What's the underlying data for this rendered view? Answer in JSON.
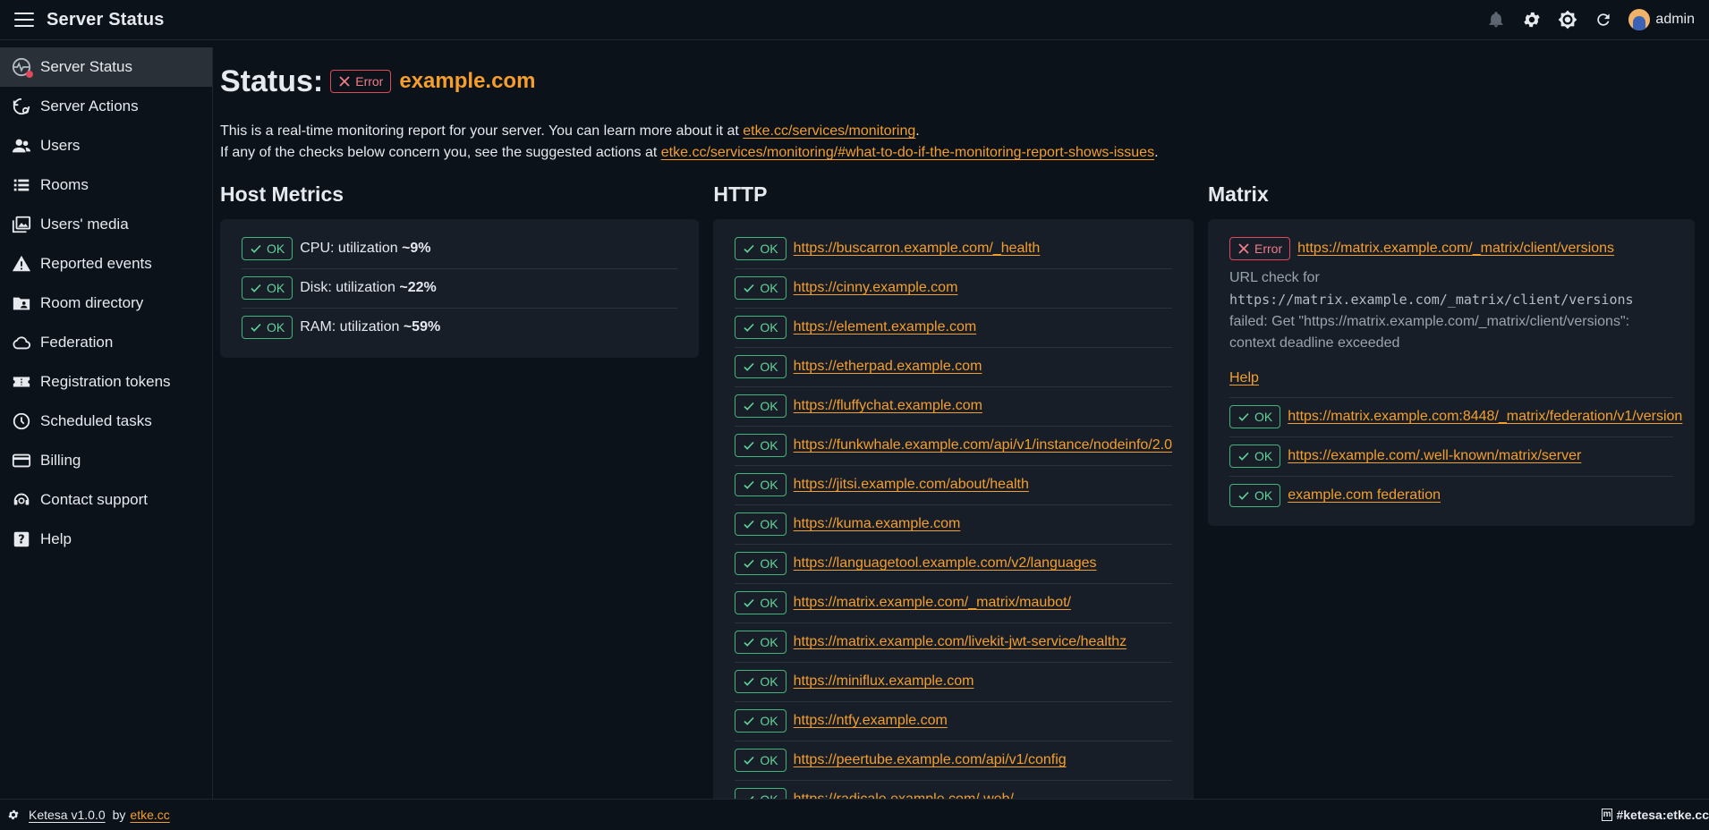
{
  "app": {
    "title": "Server Status"
  },
  "header": {
    "username": "admin"
  },
  "sidebar": {
    "items": [
      {
        "label": "Server Status"
      },
      {
        "label": "Server Actions"
      },
      {
        "label": "Users"
      },
      {
        "label": "Rooms"
      },
      {
        "label": "Users' media"
      },
      {
        "label": "Reported events"
      },
      {
        "label": "Room directory"
      },
      {
        "label": "Federation"
      },
      {
        "label": "Registration tokens"
      },
      {
        "label": "Scheduled tasks"
      },
      {
        "label": "Billing"
      },
      {
        "label": "Contact support"
      },
      {
        "label": "Help"
      }
    ]
  },
  "status": {
    "label": "Status:",
    "badge": "Error",
    "domain": "example.com"
  },
  "intro": {
    "line1_prefix": "This is a real-time monitoring report for your server. You can learn more about it at ",
    "line1_link": "etke.cc/services/monitoring",
    "line1_suffix": ".",
    "line2_prefix": "If any of the checks below concern you, see the suggested actions at ",
    "line2_link": "etke.cc/services/monitoring/#what-to-do-if-the-monitoring-report-shows-issues",
    "line2_suffix": "."
  },
  "host_metrics": {
    "title": "Host Metrics",
    "items": [
      {
        "badge": "OK",
        "prefix": "CPU: utilization ",
        "value": "~9%"
      },
      {
        "badge": "OK",
        "prefix": "Disk: utilization ",
        "value": "~22%"
      },
      {
        "badge": "OK",
        "prefix": "RAM: utilization ",
        "value": "~59%"
      }
    ]
  },
  "http": {
    "title": "HTTP",
    "items": [
      {
        "badge": "OK",
        "url": "https://buscarron.example.com/_health"
      },
      {
        "badge": "OK",
        "url": "https://cinny.example.com"
      },
      {
        "badge": "OK",
        "url": "https://element.example.com"
      },
      {
        "badge": "OK",
        "url": "https://etherpad.example.com"
      },
      {
        "badge": "OK",
        "url": "https://fluffychat.example.com"
      },
      {
        "badge": "OK",
        "url": "https://funkwhale.example.com/api/v1/instance/nodeinfo/2.0"
      },
      {
        "badge": "OK",
        "url": "https://jitsi.example.com/about/health"
      },
      {
        "badge": "OK",
        "url": "https://kuma.example.com"
      },
      {
        "badge": "OK",
        "url": "https://languagetool.example.com/v2/languages"
      },
      {
        "badge": "OK",
        "url": "https://matrix.example.com/_matrix/maubot/"
      },
      {
        "badge": "OK",
        "url": "https://matrix.example.com/livekit-jwt-service/healthz"
      },
      {
        "badge": "OK",
        "url": "https://miniflux.example.com"
      },
      {
        "badge": "OK",
        "url": "https://ntfy.example.com"
      },
      {
        "badge": "OK",
        "url": "https://peertube.example.com/api/v1/config"
      },
      {
        "badge": "OK",
        "url": "https://radicale.example.com/.web/"
      }
    ]
  },
  "matrix": {
    "title": "Matrix",
    "error": {
      "badge": "Error",
      "url": "https://matrix.example.com/_matrix/client/versions",
      "text_prefix": "URL check for ",
      "text_code": "https://matrix.example.com/_matrix/client/versions",
      "text_suffix": " failed: Get \"https://matrix.example.com/_matrix/client/versions\": context deadline exceeded",
      "help": "Help"
    },
    "items": [
      {
        "badge": "OK",
        "url": "https://matrix.example.com:8448/_matrix/federation/v1/version"
      },
      {
        "badge": "OK",
        "url": "https://example.com/.well-known/matrix/server"
      },
      {
        "badge": "OK",
        "url": "example.com federation"
      }
    ]
  },
  "footer": {
    "version": "Ketesa v1.0.0",
    "by": "by",
    "author": "etke.cc",
    "room_icon": "m",
    "room": "#ketesa:etke.cc"
  },
  "colors": {
    "accent": "#f59e2b",
    "ok": "#43b37a",
    "error": "#e0485b",
    "background": "#0c121a",
    "card": "#171e28"
  }
}
